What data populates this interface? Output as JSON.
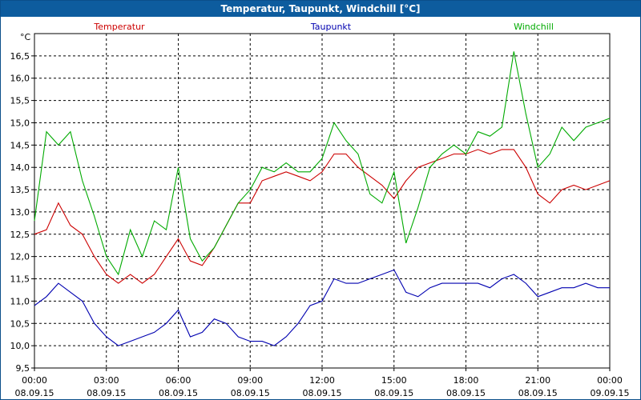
{
  "window": {
    "title": "Temperatur, Taupunkt, Windchill [°C]"
  },
  "chart_data": {
    "type": "line",
    "title": "Temperatur, Taupunkt, Windchill [°C]",
    "ylabel": "°C",
    "ylim": [
      9.5,
      17.0
    ],
    "y_ticks": [
      "9,5",
      "10,0",
      "10,5",
      "11,0",
      "11,5",
      "12,0",
      "12,5",
      "13,0",
      "13,5",
      "14,0",
      "14,5",
      "15,0",
      "15,5",
      "16,0",
      "16,5"
    ],
    "xlim_hours": [
      0,
      24
    ],
    "x_ticks": [
      {
        "time": "00:00",
        "date": "08.09.15"
      },
      {
        "time": "03:00",
        "date": "08.09.15"
      },
      {
        "time": "06:00",
        "date": "08.09.15"
      },
      {
        "time": "09:00",
        "date": "08.09.15"
      },
      {
        "time": "12:00",
        "date": "08.09.15"
      },
      {
        "time": "15:00",
        "date": "08.09.15"
      },
      {
        "time": "18:00",
        "date": "08.09.15"
      },
      {
        "time": "21:00",
        "date": "08.09.15"
      },
      {
        "time": "00:00",
        "date": "09.09.15"
      }
    ],
    "grid": true,
    "legend_placement": "top",
    "x_hours": [
      0,
      0.5,
      1,
      1.5,
      2,
      2.5,
      3,
      3.5,
      4,
      4.5,
      5,
      5.5,
      6,
      6.5,
      7,
      7.5,
      8,
      8.5,
      9,
      9.5,
      10,
      10.5,
      11,
      11.5,
      12,
      12.5,
      13,
      13.5,
      14,
      14.5,
      15,
      15.5,
      16,
      16.5,
      17,
      17.5,
      18,
      18.5,
      19,
      19.5,
      20,
      20.5,
      21,
      21.5,
      22,
      22.5,
      23,
      23.5,
      24
    ],
    "series": [
      {
        "name": "Temperatur",
        "color": "#cc0000",
        "values": [
          12.5,
          12.6,
          13.2,
          12.7,
          12.5,
          12.0,
          11.6,
          11.4,
          11.6,
          11.4,
          11.6,
          12.0,
          12.4,
          11.9,
          11.8,
          12.2,
          12.7,
          13.2,
          13.2,
          13.7,
          13.8,
          13.9,
          13.8,
          13.7,
          13.9,
          14.3,
          14.3,
          14.0,
          13.8,
          13.6,
          13.3,
          13.7,
          14.0,
          14.1,
          14.2,
          14.3,
          14.3,
          14.4,
          14.3,
          14.4,
          14.4,
          14.0,
          13.4,
          13.2,
          13.5,
          13.6,
          13.5,
          13.6,
          13.7
        ]
      },
      {
        "name": "Taupunkt",
        "color": "#0000b0",
        "values": [
          10.9,
          11.1,
          11.4,
          11.2,
          11.0,
          10.5,
          10.2,
          10.0,
          10.1,
          10.2,
          10.3,
          10.5,
          10.8,
          10.2,
          10.3,
          10.6,
          10.5,
          10.2,
          10.1,
          10.1,
          10.0,
          10.2,
          10.5,
          10.9,
          11.0,
          11.5,
          11.4,
          11.4,
          11.5,
          11.6,
          11.7,
          11.2,
          11.1,
          11.3,
          11.4,
          11.4,
          11.4,
          11.4,
          11.3,
          11.5,
          11.6,
          11.4,
          11.1,
          11.2,
          11.3,
          11.3,
          11.4,
          11.3,
          11.3
        ]
      },
      {
        "name": "Windchill",
        "color": "#00aa00",
        "values": [
          12.8,
          14.8,
          14.5,
          14.8,
          13.7,
          12.9,
          12.0,
          11.6,
          12.6,
          12.0,
          12.8,
          12.6,
          14.0,
          12.4,
          11.9,
          12.2,
          12.7,
          13.2,
          13.5,
          14.0,
          13.9,
          14.1,
          13.9,
          13.9,
          14.2,
          15.0,
          14.6,
          14.3,
          13.4,
          13.2,
          13.9,
          12.3,
          13.1,
          14.0,
          14.3,
          14.5,
          14.3,
          14.8,
          14.7,
          14.9,
          16.6,
          15.2,
          14.0,
          14.3,
          14.9,
          14.6,
          14.9,
          15.0,
          15.1
        ]
      }
    ]
  }
}
